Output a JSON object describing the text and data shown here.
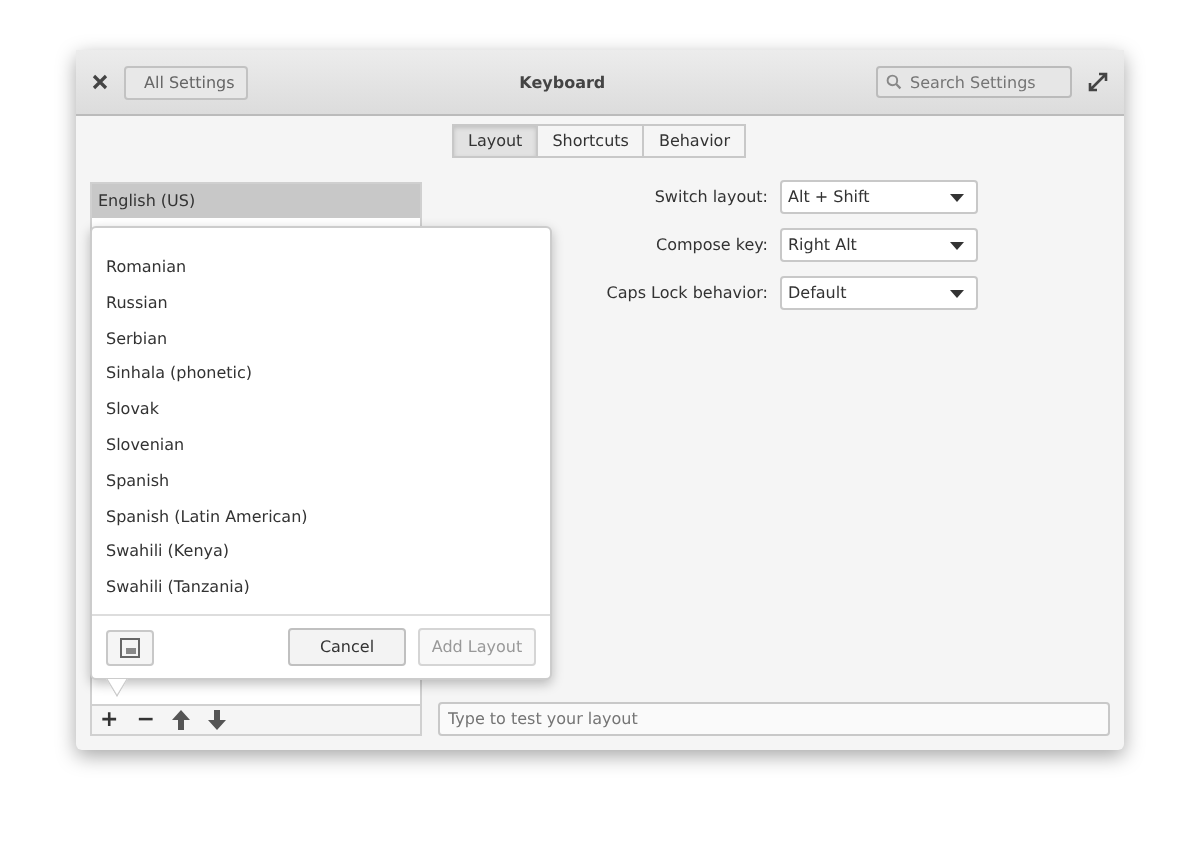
{
  "window": {
    "title": "Keyboard",
    "back_button": "All Settings",
    "search": {
      "placeholder": "Search Settings"
    }
  },
  "tabs": [
    {
      "label": "Layout",
      "selected": true
    },
    {
      "label": "Shortcuts",
      "selected": false
    },
    {
      "label": "Behavior",
      "selected": false
    }
  ],
  "layouts": [
    {
      "label": "English (US)",
      "selected": true
    }
  ],
  "popover": {
    "items": [
      "Romanian",
      "Russian",
      "Serbian",
      "Sinhala (phonetic)",
      "Slovak",
      "Slovenian",
      "Spanish",
      "Spanish (Latin American)",
      "Swahili (Kenya)",
      "Swahili (Tanzania)"
    ],
    "buttons": [
      {
        "label": "Cancel",
        "disabled": false
      },
      {
        "label": "Add Layout",
        "disabled": true
      }
    ]
  },
  "toolbar": [
    "+",
    "−"
  ],
  "settings": [
    {
      "label": "Switch layout:",
      "value": "Alt + Shift"
    },
    {
      "label": "Compose key:",
      "value": "Right Alt"
    },
    {
      "label": "Caps Lock behavior:",
      "value": "Default"
    }
  ],
  "test_field": {
    "placeholder": "Type to test your layout"
  }
}
